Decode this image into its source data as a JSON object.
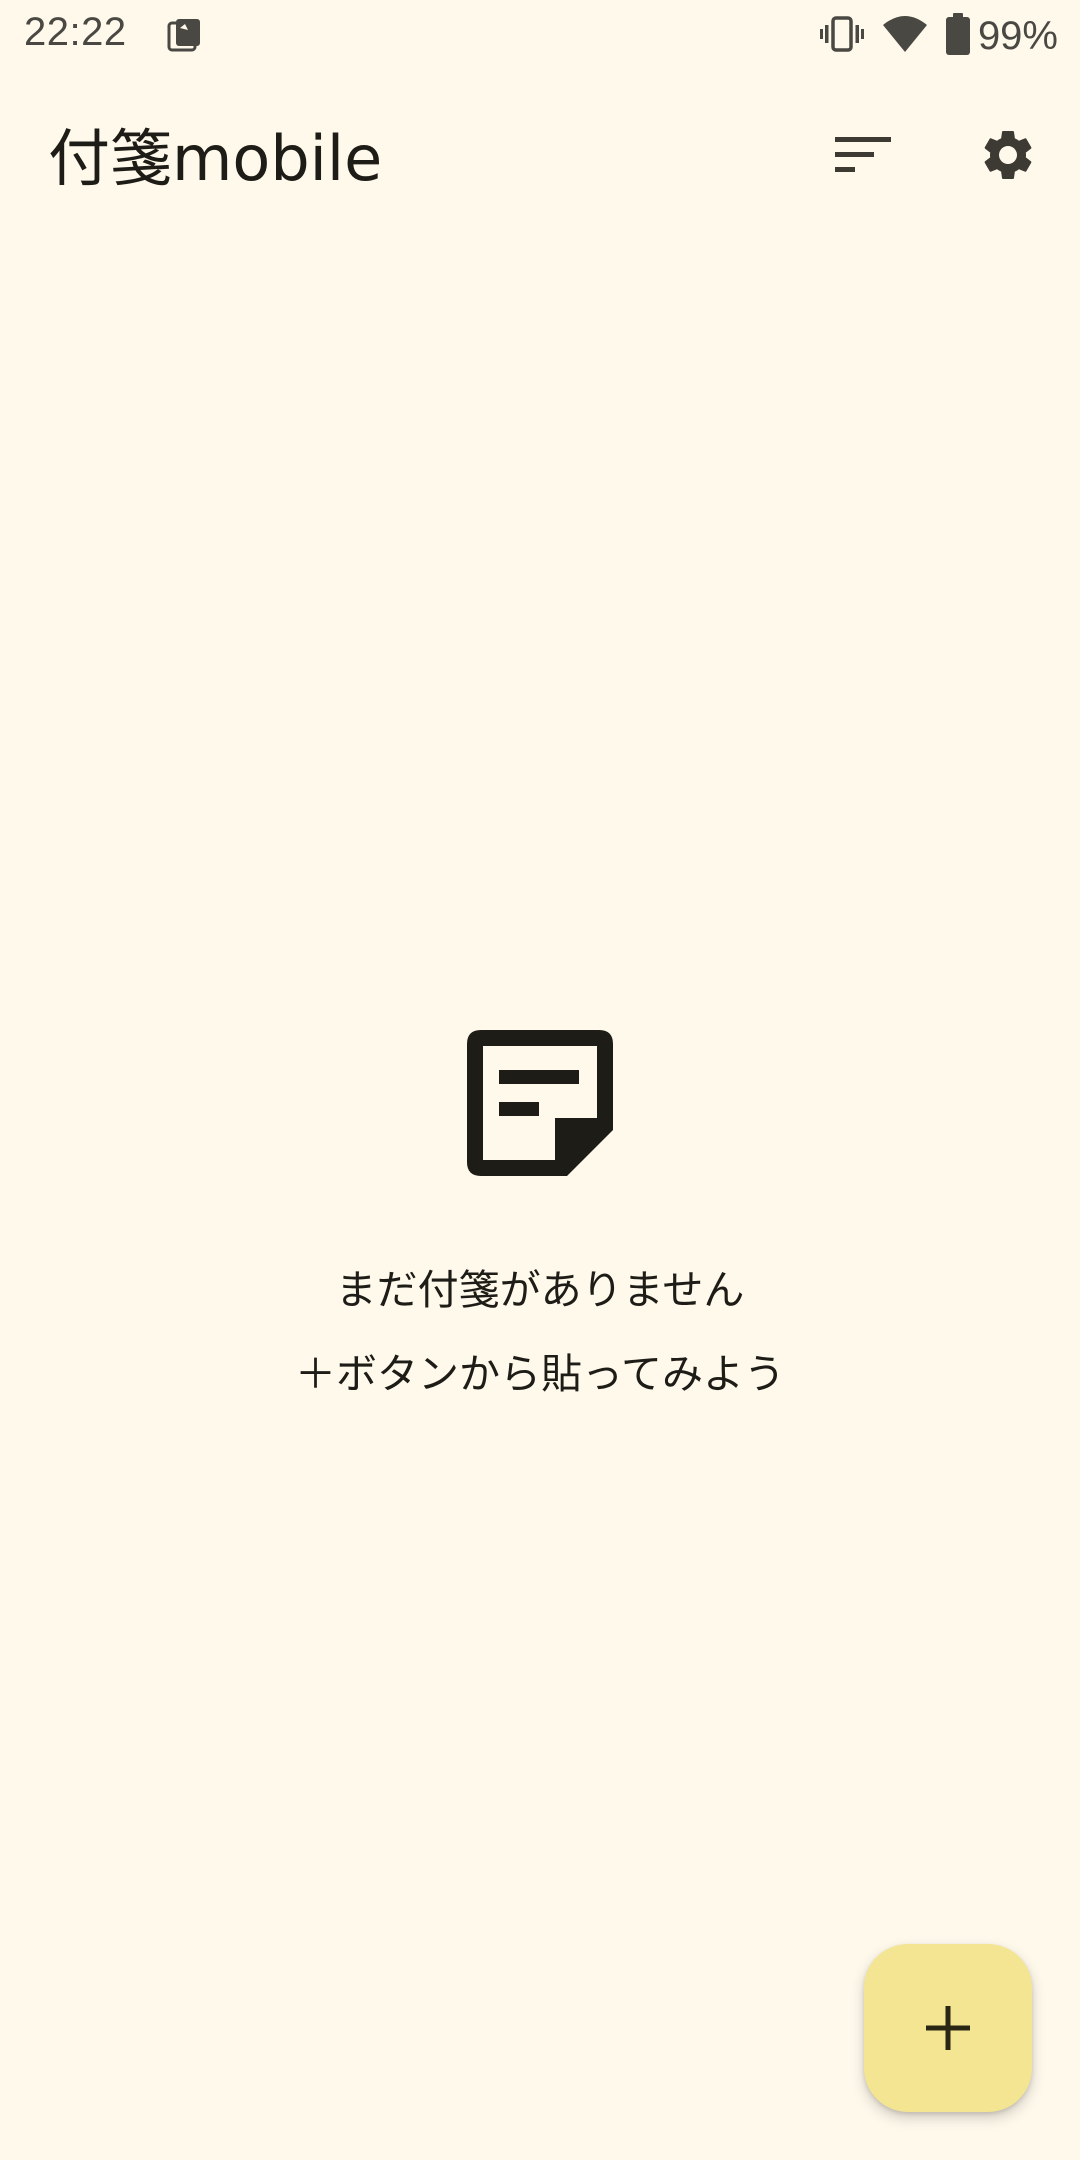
{
  "status_bar": {
    "time": "22:22",
    "battery_percent": "99%",
    "icons": [
      "notification-icon",
      "vibrate-icon",
      "wifi-icon",
      "battery-icon"
    ]
  },
  "app_bar": {
    "title": "付箋mobile",
    "actions": [
      {
        "name": "sort",
        "icon": "sort-icon"
      },
      {
        "name": "settings",
        "icon": "gear-icon"
      }
    ]
  },
  "empty_state": {
    "icon": "sticky-note-icon",
    "line1": "まだ付箋がありません",
    "line2": "＋ボタンから貼ってみよう"
  },
  "fab": {
    "icon": "plus-icon",
    "color": "#F3E592"
  },
  "colors": {
    "background": "#FFF9EC",
    "text": "#1E1C16",
    "icon": "#4A4842"
  }
}
